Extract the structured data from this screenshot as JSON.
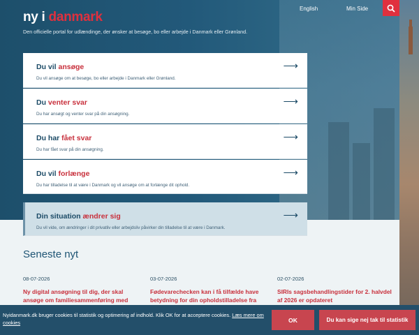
{
  "header": {
    "logo_part1": "ny i ",
    "logo_part2": "danmark",
    "tagline": "Den officielle portal for udlændinge, der ønsker at besøge, bo eller arbejde i Danmark eller Grønland.",
    "nav_english": "English",
    "nav_min_side": "Min Side",
    "search_icon": "search-icon"
  },
  "cards": [
    {
      "pre": "Du vil ",
      "hl": "ansøge",
      "post": "",
      "desc": "Du vil ansøge om at besøge, bo eller arbejde i Danmark eller Grønland.",
      "arrow": "⟶"
    },
    {
      "pre": "Du ",
      "hl": "venter svar",
      "post": "",
      "desc": "Du har ansøgt og venter svar på din ansøgning.",
      "arrow": "⟶"
    },
    {
      "pre": "Du har ",
      "hl": "fået svar",
      "post": "",
      "desc": "Du har fået svar på din ansøgning.",
      "arrow": "⟶"
    },
    {
      "pre": "Du vil ",
      "hl": "forlænge",
      "post": "",
      "desc": "Du har tilladelse til at være i Danmark og vil ansøge om at forlænge dit ophold.",
      "arrow": "⟶"
    },
    {
      "pre": "Din situation ",
      "hl": "ændrer sig",
      "post": "",
      "desc": "Du vil vide, om ændringer i dit privatliv eller arbejdsliv påvirker din tilladelse til at være i Danmark.",
      "arrow": "⟶"
    }
  ],
  "news": {
    "heading": "Seneste nyt",
    "items": [
      {
        "date": "08-07-2026",
        "title": "Ny digital ansøgning til dig, der skal ansøge om familiesammenføring med"
      },
      {
        "date": "03-07-2026",
        "title": "Fødevarechecken kan i få tilfælde have betydning for din opholdstilladelse fra"
      },
      {
        "date": "02-07-2026",
        "title": "SIRIs sagsbehandlingstider for 2. halvdel af 2026 er opdateret"
      }
    ]
  },
  "cookie": {
    "text": "Nyidanmark.dk bruger cookies til statistik og optimering af indhold. Klik OK for at acceptere cookies. ",
    "link": "Læs mere om cookies",
    "ok": "OK",
    "decline": "Du kan sige nej tak til statistik"
  },
  "colors": {
    "brand_red": "#e0303e",
    "brand_blue": "#1b4a66"
  }
}
